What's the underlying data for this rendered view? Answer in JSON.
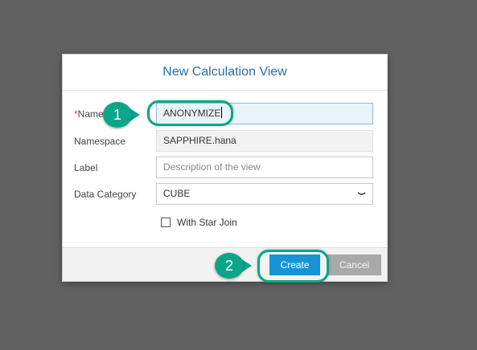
{
  "dialog": {
    "title": "New Calculation View",
    "fields": {
      "name": {
        "required_mark": "*",
        "label": "Name",
        "value": "ANONYMIZE"
      },
      "namespace": {
        "label": "Namespace",
        "value": "SAPPHIRE.hana"
      },
      "label": {
        "label": "Label",
        "placeholder": "Description of the view"
      },
      "data_category": {
        "label": "Data Category",
        "value": "CUBE",
        "icon": "chevron-down-icon"
      }
    },
    "star_join": {
      "label": "With Star Join",
      "checked": false
    },
    "footer": {
      "create_label": "Create",
      "cancel_label": "Cancel"
    }
  },
  "annotations": {
    "step1": "1",
    "step2": "2",
    "accent": "#0ba58a"
  }
}
